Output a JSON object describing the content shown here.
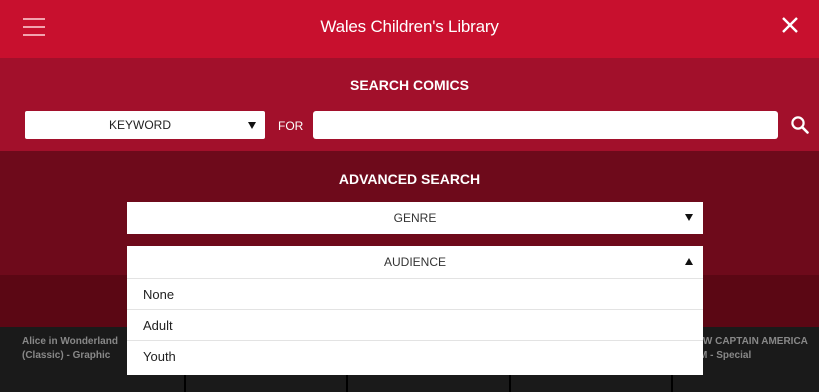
{
  "header": {
    "title": "Wales Children's Library",
    "menu_icon": "hamburger-icon",
    "close_icon": "close-icon"
  },
  "search": {
    "title": "SEARCH COMICS",
    "field_select": "KEYWORD",
    "for_label": "FOR",
    "input_value": "",
    "input_placeholder": "",
    "search_icon": "search-icon"
  },
  "advanced": {
    "title": "ADVANCED SEARCH",
    "genre_label": "GENRE",
    "audience_label": "AUDIENCE",
    "audience_options": [
      "None",
      "Adult",
      "Youth"
    ]
  },
  "books": {
    "left_title_line1": "Alice in Wonderland",
    "left_title_line2": "(Classic) - Graphic",
    "right_title_line1": "NEW CAPTAIN AMERICA",
    "right_title_line2": "HIM - Special"
  },
  "colors": {
    "header_red": "#c8102e",
    "search_red": "#a2102b",
    "advanced_red": "#6e0a1b"
  }
}
